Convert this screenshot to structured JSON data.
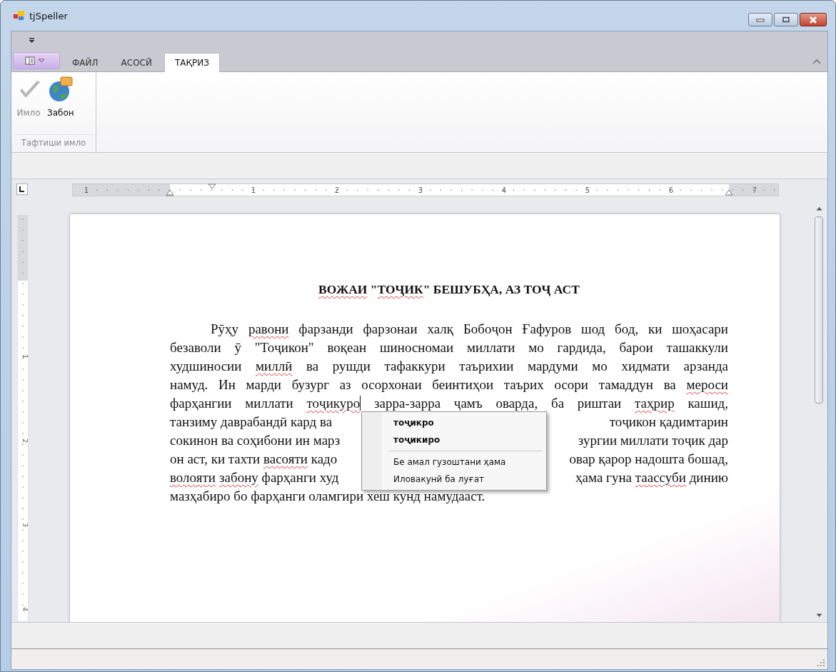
{
  "window": {
    "title": "tjSpeller"
  },
  "ribbon": {
    "tabs": [
      {
        "label": "ФАЙЛ",
        "selected": false
      },
      {
        "label": "АСОСӢ",
        "selected": false
      },
      {
        "label": "ТАҚРИЗ",
        "selected": true
      }
    ],
    "group": {
      "label": "Тафтиши имло",
      "buttons": [
        {
          "label": "Имло",
          "disabled": true,
          "kind": "check"
        },
        {
          "label": "Забон",
          "disabled": false,
          "kind": "globe"
        }
      ]
    }
  },
  "ruler": {
    "labels": [
      "1",
      "1",
      "2",
      "3",
      "4",
      "5",
      "6",
      "7"
    ],
    "vertical_labels": [
      "1",
      "2",
      "3",
      "4"
    ]
  },
  "document": {
    "title": [
      {
        "text": "ВОЖАИ",
        "misspelled": true
      },
      {
        "text": " \"",
        "misspelled": false
      },
      {
        "text": "ТОҶИК",
        "misspelled": true
      },
      {
        "text": "\" БЕШУБҲА, АЗ ТОҶ АСТ",
        "misspelled": false
      }
    ],
    "lines": [
      {
        "left": [
          {
            "text": "Рӯҳу ",
            "misspelled": false
          },
          {
            "text": "равони",
            "misspelled": true
          },
          {
            "text": " фарзанди фарзонаи халқ Бобоҷон Ғафуров шод бод, ки шоҳасари",
            "misspelled": false
          }
        ]
      },
      {
        "left": [
          {
            "text": "безаволи ӯ \"Тоҷикон\" воқеан шиносномаи миллати мо гардида, барои ташаккули",
            "misspelled": false
          }
        ]
      },
      {
        "left": [
          {
            "text": "худшиносии ",
            "misspelled": false
          },
          {
            "text": "миллӣ",
            "misspelled": true
          },
          {
            "text": " ва рушди тафаккури таърихии мардуми мо хидмати арзанда",
            "misspelled": false
          }
        ]
      },
      {
        "left": [
          {
            "text": "намуд. Ин марди бузург аз осорхонаи беинтиҳои таърих осори тамаддун ва ",
            "misspelled": false
          },
          {
            "text": "мероси",
            "misspelled": true
          }
        ]
      },
      {
        "left": [
          {
            "text": "фарҳангии миллати ",
            "misspelled": false
          },
          {
            "text": "тоҷикуро",
            "misspelled": true,
            "caret_after": true
          },
          {
            "text": " зарра-зарра ҷамъ оварда, ба риштаи ",
            "misspelled": false
          },
          {
            "text": "таҳрир",
            "misspelled": true
          },
          {
            "text": " кашид,",
            "misspelled": false
          }
        ]
      },
      {
        "left": [
          {
            "text": "танзиму даврабандӣ кард ва",
            "misspelled": false
          }
        ],
        "right": [
          {
            "text": "тоҷикон қадимтарин",
            "misspelled": false
          }
        ]
      },
      {
        "left": [
          {
            "text": "сокинон ва соҳибони ин марз",
            "misspelled": false
          }
        ],
        "right": [
          {
            "text": "зургии миллати тоҷик дар",
            "misspelled": false
          }
        ]
      },
      {
        "left": [
          {
            "text": "он аст, ки тахти ",
            "misspelled": false
          },
          {
            "text": "васояти",
            "misspelled": true
          },
          {
            "text": " кадо",
            "misspelled": false
          }
        ],
        "right": [
          {
            "text": "овар қарор надошта бошад,",
            "misspelled": false
          }
        ]
      },
      {
        "left": [
          {
            "text": "волояти",
            "misspelled": true
          },
          {
            "text": "забону",
            "misspelled": true
          },
          {
            "text": " фарҳанги худ",
            "misspelled": false
          }
        ],
        "right": [
          {
            "text": "ҳама гуна ",
            "misspelled": false
          },
          {
            "text": "таассуби",
            "misspelled": true
          },
          {
            "text": " динию",
            "misspelled": false
          }
        ]
      },
      {
        "left": [
          {
            "text": "мазҳабиро бо фарҳанги оламгири хеш кунд намудааст.",
            "misspelled": false
          }
        ]
      }
    ]
  },
  "context_menu": {
    "items": [
      {
        "label": "тоҷикро",
        "kind": "suggestion"
      },
      {
        "label": "тоҷикиро",
        "kind": "suggestion"
      },
      {
        "label": "Бе амал гузоштани ҳама",
        "kind": "action"
      },
      {
        "label": "Иловакунӣ ба луғат",
        "kind": "action"
      }
    ]
  }
}
